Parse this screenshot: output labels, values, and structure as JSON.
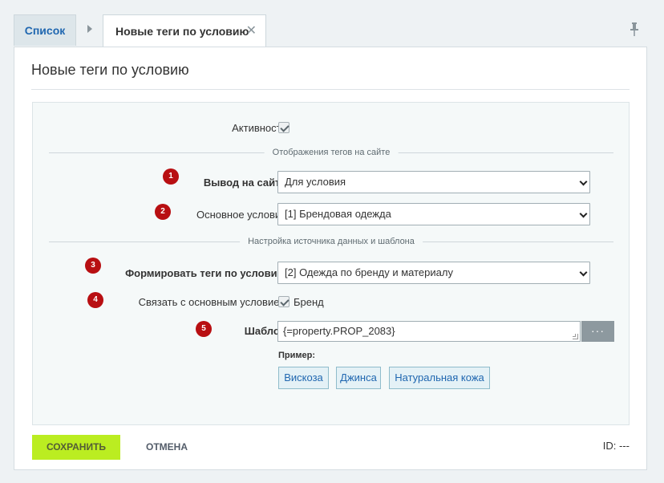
{
  "tabs": {
    "list_label": "Список",
    "active_label": "Новые теги по условию",
    "close_glyph": "✕"
  },
  "panel": {
    "title": "Новые теги по условию"
  },
  "form": {
    "active_label": "Активность:",
    "active_checked": true,
    "section_display": "Отображения тегов на сайте",
    "output_label": "Вывод на сайте:",
    "output_value": "Для условия",
    "main_condition_label": "Основное условие:",
    "main_condition_value": "[1] Брендовая одежда",
    "section_source": "Настройка источника данных и шаблона",
    "generate_label": "Формировать теги по условию:",
    "generate_value": "[2] Одежда по бренду и материалу",
    "link_label": "Связать с основным условием:",
    "link_checked": true,
    "link_value": "Бренд",
    "template_label": "Шаблон:",
    "template_value": "{=property.PROP_2083}",
    "dots_label": "···",
    "example_label": "Пример:",
    "examples": [
      "Вискоза",
      "Джинса",
      "Натуральная кожа"
    ]
  },
  "badges": [
    "1",
    "2",
    "3",
    "4",
    "5"
  ],
  "footer": {
    "save_label": "СОХРАНИТЬ",
    "cancel_label": "ОТМЕНА",
    "id_label": "ID: ---"
  },
  "colors": {
    "accent": "#bbed21",
    "badge": "#b80f12",
    "link": "#2067b0",
    "chip_bg": "#e4f1f6",
    "chip_border": "#8fbccb"
  },
  "icons": {
    "tab_arrow": "triangle-right-icon",
    "pin": "pin-icon",
    "select_chevron": "chevron-down-icon",
    "checkbox_check": "check-icon"
  }
}
